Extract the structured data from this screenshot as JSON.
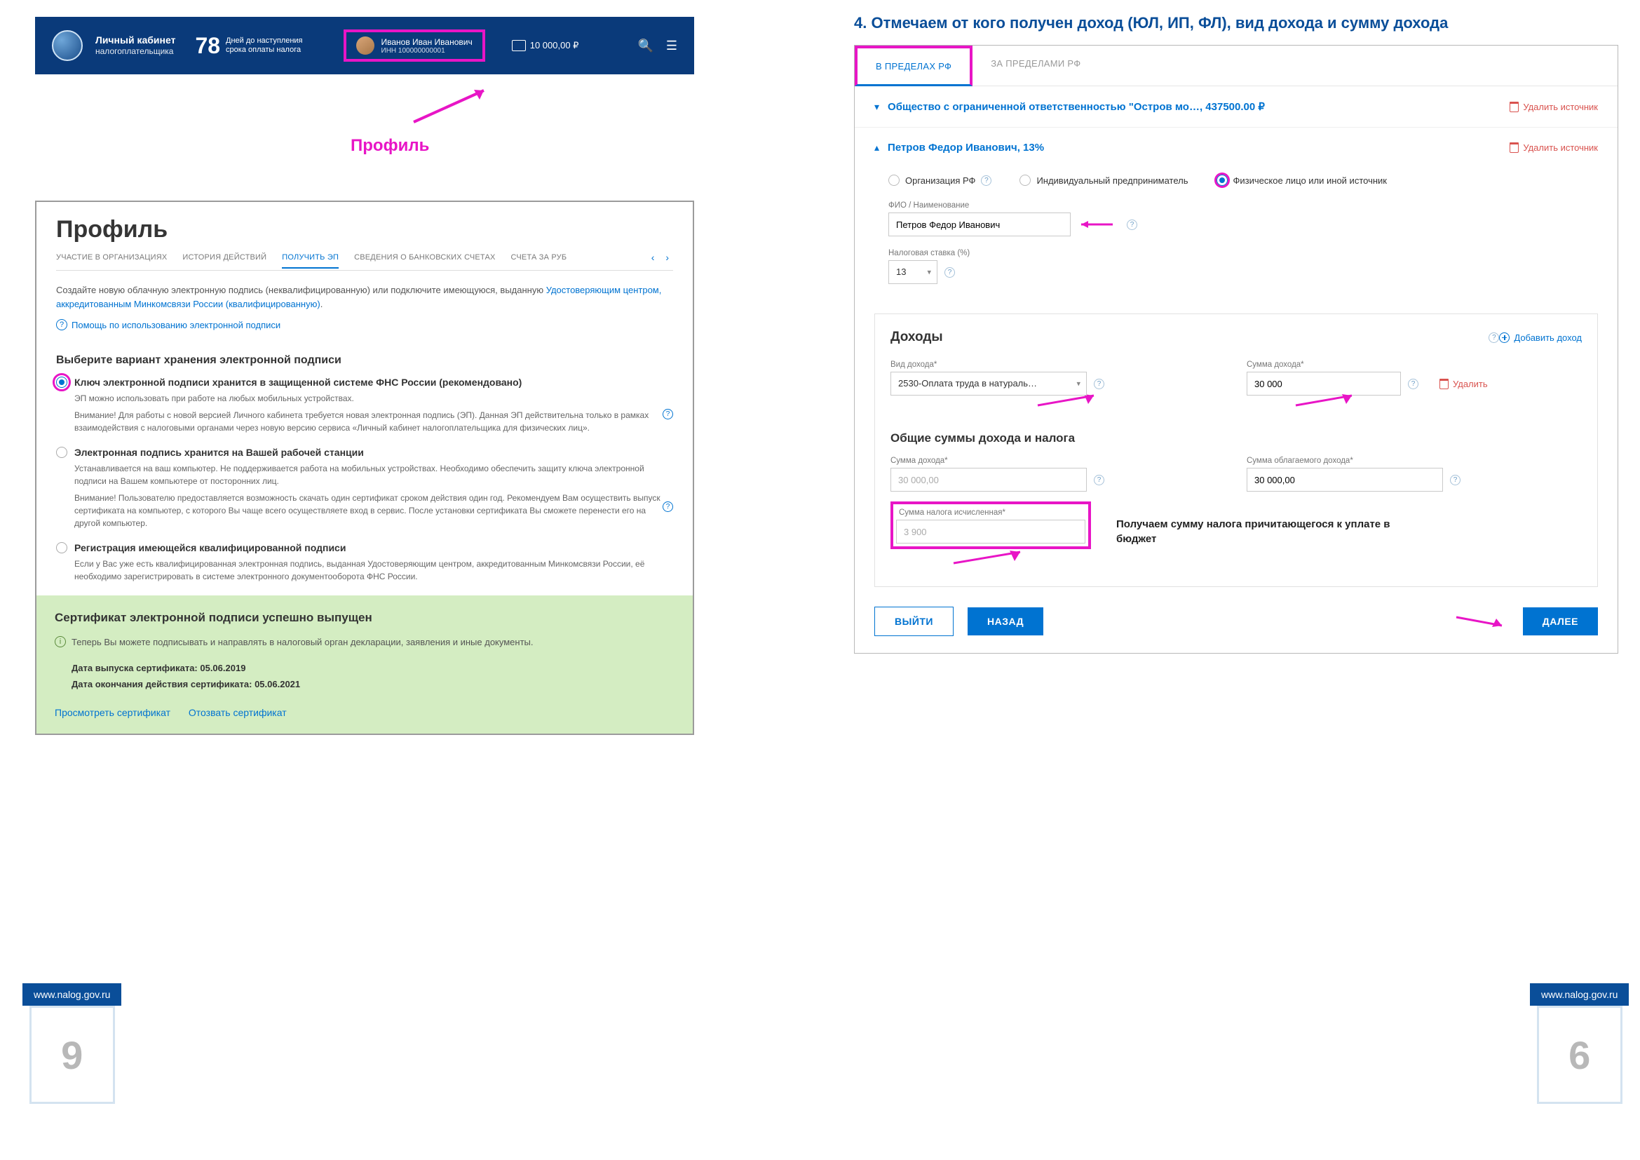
{
  "left": {
    "header": {
      "title1": "Личный кабинет",
      "title2": "налогоплательщика",
      "days_number": "78",
      "days_text1": "Дней до наступления",
      "days_text2": "срока оплаты налога",
      "user_name": "Иванов Иван Иванович",
      "user_inn": "ИНН 100000000001",
      "wallet_amount": "10 000,00 ₽"
    },
    "profile_label": "Профиль",
    "panel_title": "Профиль",
    "tabs": {
      "t1": "УЧАСТИЕ В ОРГАНИЗАЦИЯХ",
      "t2": "ИСТОРИЯ ДЕЙСТВИЙ",
      "t3": "ПОЛУЧИТЬ ЭП",
      "t4": "СВЕДЕНИЯ О БАНКОВСКИХ СЧЕТАХ",
      "t5": "СЧЕТА ЗА РУБ"
    },
    "intro_part1": "Создайте новую облачную электронную подпись (неквалифицированную) или подключите имеющуюся, выданную ",
    "intro_link": "Удостоверяющим центром, аккредитованным Минкомсвязи России (квалифицированную)",
    "intro_part2": ".",
    "help_link": "Помощь по использованию электронной подписи",
    "section_h": "Выберите вариант хранения электронной подписи",
    "opt1": {
      "title": "Ключ электронной подписи хранится в защищенной системе ФНС России (рекомендовано)",
      "line1": "ЭП можно использовать при работе на любых мобильных устройствах.",
      "line2": "Внимание! Для работы с новой версией Личного кабинета требуется новая электронная подпись (ЭП). Данная ЭП действительна только в рамках взаимодействия с налоговыми органами через новую версию сервиса «Личный кабинет налогоплательщика для физических лиц».",
      "warn_label": "Внимание!"
    },
    "opt2": {
      "title": "Электронная подпись хранится на Вашей рабочей станции",
      "line1": "Устанавливается на ваш компьютер. Не поддерживается работа на мобильных устройствах. Необходимо обеспечить защиту ключа электронной подписи на Вашем компьютере от посторонних лиц.",
      "line2": "Внимание! Пользователю предоставляется возможность скачать один сертификат сроком действия один год. Рекомендуем Вам осуществить выпуск сертификата на компьютер, с которого Вы чаще всего осуществляете вход в сервис. После установки сертификата Вы сможете перенести его на другой компьютер."
    },
    "opt3": {
      "title": "Регистрация имеющейся квалифицированной подписи",
      "line1": "Если у Вас уже есть квалифицированная электронная подпись, выданная Удостоверяющим центром, аккредитованным Минкомсвязи России, её необходимо зарегистрировать в системе электронного документооборота ФНС России."
    },
    "success": {
      "heading": "Сертификат электронной подписи успешно выпущен",
      "sub": "Теперь Вы можете подписывать и направлять в налоговый орган декларации, заявления и иные документы.",
      "date_issue_label": "Дата выпуска сертификата: ",
      "date_issue": "05.06.2019",
      "date_end_label": "Дата окончания действия сертификата: ",
      "date_end": "05.06.2021",
      "view": "Просмотреть сертификат",
      "revoke": "Отозвать сертификат"
    }
  },
  "right": {
    "step_title": "4. Отмечаем от кого получен доход (ЮЛ, ИП, ФЛ), вид дохода и сумму дохода",
    "tabs": {
      "t1": "В ПРЕДЕЛАХ РФ",
      "t2": "ЗА ПРЕДЕЛАМИ РФ"
    },
    "source1": {
      "title": "Общество с ограниченной ответственностью \"Остров мо…, 437500.00 ₽",
      "del": "Удалить источник"
    },
    "source2": {
      "title": "Петров Федор Иванович, 13%",
      "del": "Удалить источник"
    },
    "radios": {
      "r1": "Организация РФ",
      "r2": "Индивидуальный предприниматель",
      "r3": "Физическое лицо или иной источник"
    },
    "fio_label": "ФИО / Наименование",
    "fio_value": "Петров Федор Иванович",
    "rate_label": "Налоговая ставка (%)",
    "rate_value": "13",
    "income": {
      "heading": "Доходы",
      "add": "Добавить доход",
      "kind_label": "Вид дохода*",
      "kind_value": "2530-Оплата труда в натураль…",
      "sum_label": "Сумма дохода*",
      "sum_value": "30 000",
      "delete": "Удалить",
      "totals_heading": "Общие суммы дохода и налога",
      "total_income_label": "Сумма дохода*",
      "total_income": "30 000,00",
      "taxable_label": "Сумма облагаемого дохода*",
      "taxable": "30 000,00",
      "tax_calc_label": "Сумма налога исчисленная*",
      "tax_calc": "3 900",
      "note": "Получаем сумму налога причитающегося к уплате в бюджет"
    },
    "buttons": {
      "exit": "ВЫЙТИ",
      "back": "НАЗАД",
      "next": "ДАЛЕЕ"
    }
  },
  "footer": {
    "url": "www.nalog.gov.ru",
    "page_left": "9",
    "page_right": "6"
  }
}
